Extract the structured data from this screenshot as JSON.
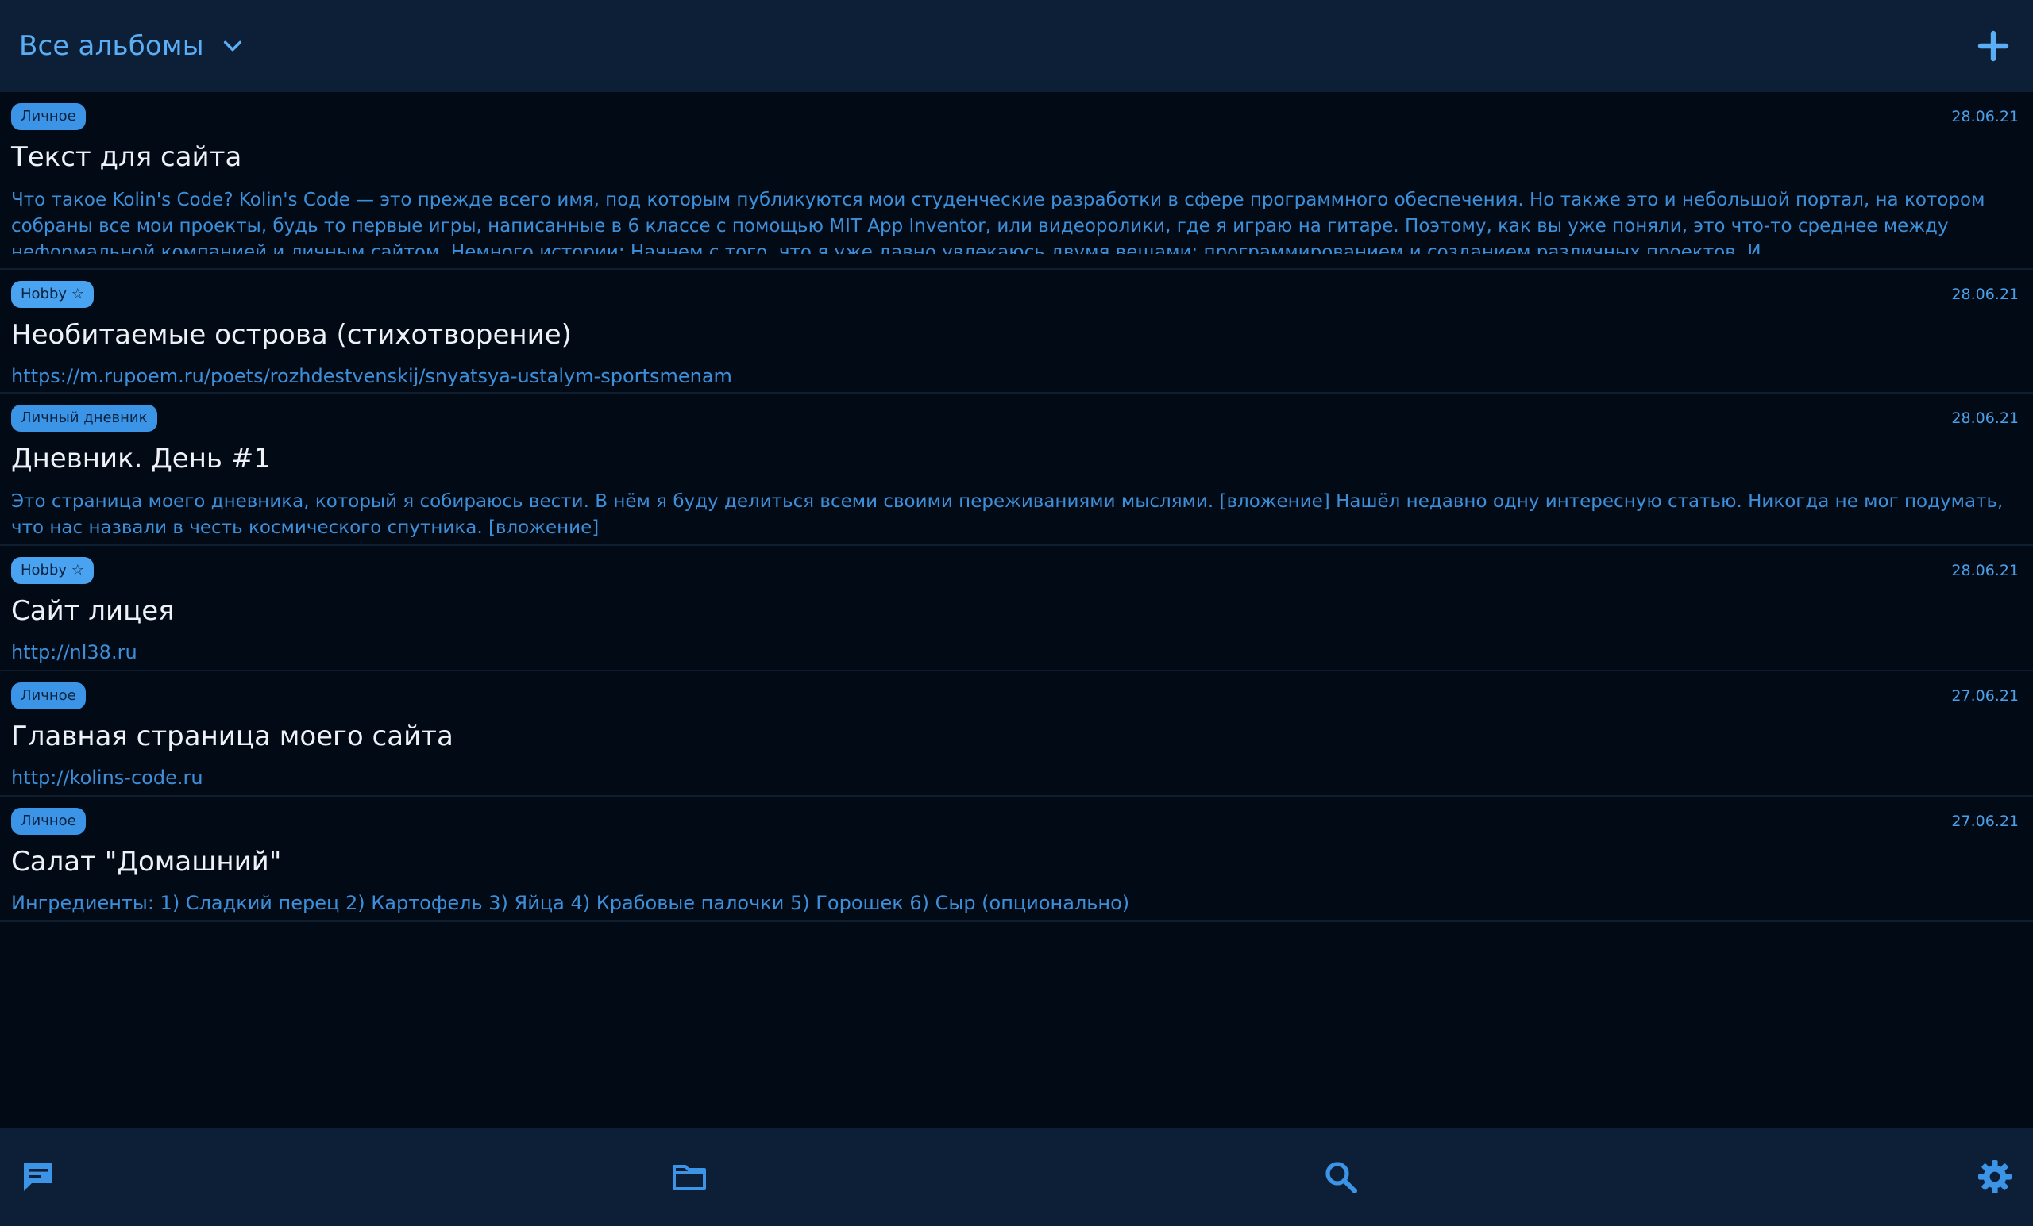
{
  "header": {
    "album_label": "Все альбомы",
    "icons": {
      "dropdown": "chevron-down-icon",
      "add": "plus-icon"
    },
    "accent_color": "#5aaef5"
  },
  "notes": [
    {
      "tag": "Личное",
      "date": "28.06.21",
      "title": "Текст для сайта",
      "text": "Что такое Kolin's Code? Kolin's Code — это прежде всего имя, под которым публикуются мои студенческие разработки в сфере программного обеспечения. Но также это и небольшой портал, на котором собраны все мои проекты, будь то первые игры, написанные в 6 классе с помощью MIT App Inventor, или видеоролики, где я играю на гитаре. Поэтому, как вы уже поняли, это что-то среднее между неформальной компанией и личным сайтом. Немного истории: Начнем с того, что я уже давно увлекаюсь двумя вещами: программированием и созданием различных проектов. И"
    },
    {
      "tag": "Hobby ☆",
      "date": "28.06.21",
      "title": "Необитаемые острова (стихотворение)",
      "text": "https://m.rupoem.ru/poets/rozhdestvenskij/snyatsya-ustalym-sportsmenam"
    },
    {
      "tag": "Личный дневник",
      "date": "28.06.21",
      "title": "Дневник. День #1",
      "text": "Это страница моего дневника, который я собираюсь вести. В нём я буду делиться всеми своими переживаниями мыслями. [вложение] Нашёл недавно одну интересную статью. Никогда не мог подумать, что нас назвали в честь космического спутника. [вложение]"
    },
    {
      "tag": "Hobby ☆",
      "date": "28.06.21",
      "title": "Сайт лицея",
      "text": "http://nl38.ru"
    },
    {
      "tag": "Личное",
      "date": "27.06.21",
      "title": "Главная страница моего сайта",
      "text": "http://kolins-code.ru"
    },
    {
      "tag": "Личное",
      "date": "27.06.21",
      "title": "Салат \"Домашний\"",
      "text": "Ингредиенты: 1) Сладкий перец 2) Картофель 3) Яйца 4) Крабовые палочки 5) Горошек 6) Сыр (опционально)"
    }
  ],
  "bottom_nav": {
    "icons": [
      "notes-icon",
      "folder-icon",
      "search-icon",
      "gear-icon"
    ]
  }
}
